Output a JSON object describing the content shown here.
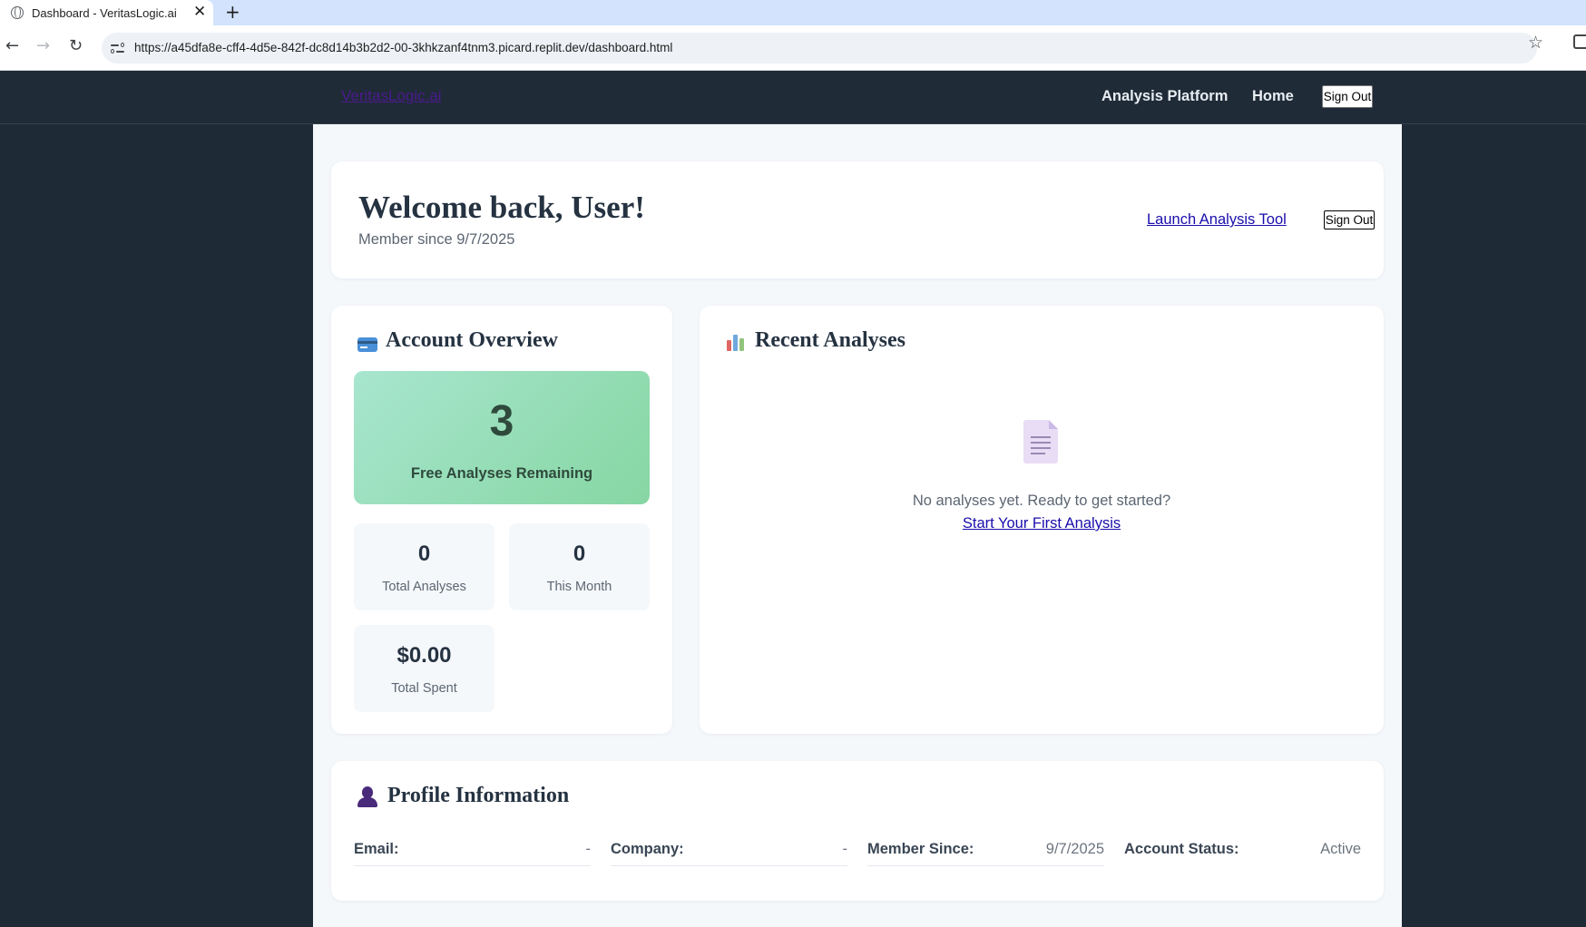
{
  "browser": {
    "tab_title": "Dashboard - VeritasLogic.ai",
    "url": "https://a45dfa8e-cff4-4d5e-842f-dc8d14b3b2d2-00-3khkzanf4tnm3.picard.replit.dev/dashboard.html"
  },
  "nav": {
    "brand": "VeritasLogic.ai",
    "links": [
      "Analysis Platform",
      "Home"
    ],
    "signout": "Sign Out"
  },
  "welcome": {
    "title": "Welcome back, User!",
    "member_since": "Member since 9/7/2025",
    "launch_link": "Launch Analysis Tool",
    "signout": "Sign Out"
  },
  "overview": {
    "title": "Account Overview",
    "icon": "credit-card-icon",
    "free_remaining": "3",
    "free_label": "Free Analyses Remaining",
    "stats": [
      {
        "value": "0",
        "label": "Total Analyses"
      },
      {
        "value": "0",
        "label": "This Month"
      },
      {
        "value": "$0.00",
        "label": "Total Spent"
      }
    ]
  },
  "recent": {
    "title": "Recent Analyses",
    "icon": "bar-chart-icon",
    "empty_icon": "document-icon",
    "empty_message": "No analyses yet. Ready to get started?",
    "cta": "Start Your First Analysis"
  },
  "profile": {
    "title": "Profile Information",
    "icon": "user-icon",
    "fields": [
      {
        "label": "Email:",
        "value": "-"
      },
      {
        "label": "Company:",
        "value": "-"
      },
      {
        "label": "Member Since:",
        "value": "9/7/2025"
      },
      {
        "label": "Account Status:",
        "value": "Active"
      }
    ]
  },
  "colors": {
    "nav_bg": "#1f2b37",
    "accent_green": "#86d6a2",
    "link": "#1a0dab",
    "brand": "#4b1a8c"
  }
}
